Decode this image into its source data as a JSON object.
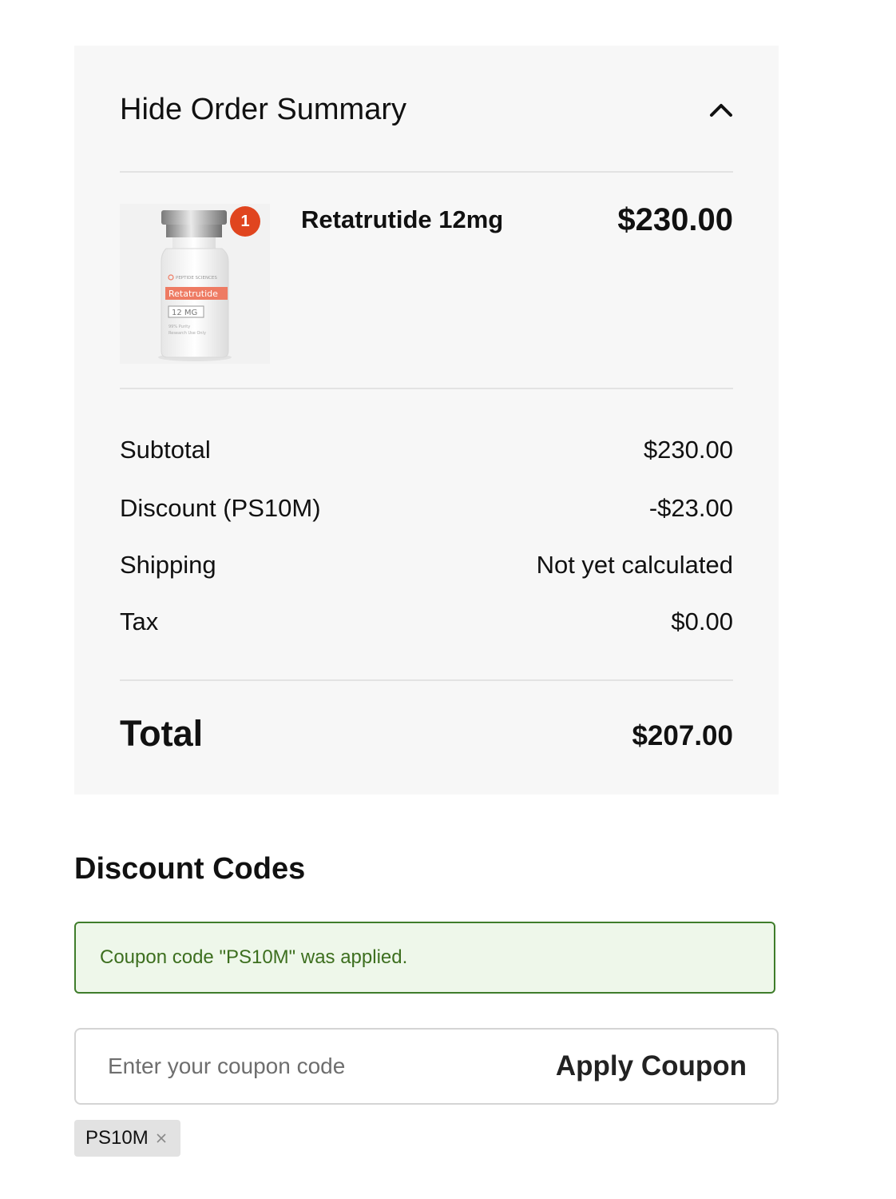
{
  "summary": {
    "toggle_label": "Hide Order Summary",
    "toggle_icon": "chevron-up-icon"
  },
  "product": {
    "name": "Retatrutide 12mg",
    "price": "$230.00",
    "quantity": "1",
    "vial_brand": "PEPTIDE SCIENCES",
    "vial_label": "Retatrutide",
    "vial_dose": "12 MG",
    "vial_purity": "99% Purity",
    "vial_use": "Research Use Only"
  },
  "totals": {
    "subtotal_label": "Subtotal",
    "subtotal_value": "$230.00",
    "discount_label": "Discount (PS10M)",
    "discount_value": "-$23.00",
    "shipping_label": "Shipping",
    "shipping_value": "Not yet calculated",
    "tax_label": "Tax",
    "tax_value": "$0.00",
    "total_label": "Total",
    "total_value": "$207.00"
  },
  "discount": {
    "heading": "Discount Codes",
    "notice": "Coupon code \"PS10M\" was applied.",
    "input_placeholder": "Enter your coupon code",
    "input_value": "",
    "apply_label": "Apply Coupon",
    "applied_code": "PS10M"
  },
  "colors": {
    "panel_bg": "#f7f7f7",
    "badge": "#e0451f",
    "notice_bg": "#eef7ea",
    "notice_border": "#3f7d2b",
    "notice_text": "#3d6f1f",
    "vial_accent": "#ee7b63"
  }
}
